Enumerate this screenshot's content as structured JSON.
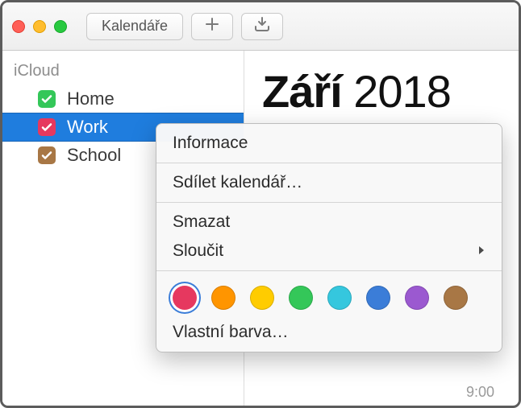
{
  "toolbar": {
    "calendars_label": "Kalendáře"
  },
  "sidebar": {
    "section": "iCloud",
    "items": [
      {
        "label": "Home",
        "color": "#34c759",
        "checked": true,
        "selected": false
      },
      {
        "label": "Work",
        "color": "#e6385f",
        "checked": true,
        "selected": true
      },
      {
        "label": "School",
        "color": "#a87745",
        "checked": true,
        "selected": false
      }
    ]
  },
  "main": {
    "month": "Září",
    "year": "2018",
    "time_label": "9:00"
  },
  "context_menu": {
    "info": "Informace",
    "share": "Sdílet kalendář…",
    "delete": "Smazat",
    "merge": "Sloučit",
    "custom_color": "Vlastní barva…",
    "colors": [
      {
        "hex": "#e6385f",
        "selected": true
      },
      {
        "hex": "#ff9500",
        "selected": false
      },
      {
        "hex": "#ffcc00",
        "selected": false
      },
      {
        "hex": "#34c759",
        "selected": false
      },
      {
        "hex": "#35c7de",
        "selected": false
      },
      {
        "hex": "#3b7dd8",
        "selected": false
      },
      {
        "hex": "#9b59d0",
        "selected": false
      },
      {
        "hex": "#a87745",
        "selected": false
      }
    ]
  }
}
